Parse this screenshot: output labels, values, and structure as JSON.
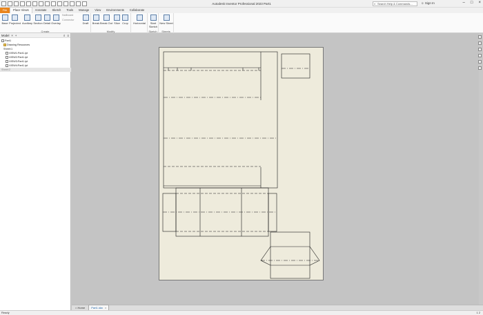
{
  "window": {
    "title": "Autodesk Inventor Professional 2023   Part1",
    "search_placeholder": "Search Help & Commands...",
    "sign_in": "Sign In"
  },
  "tabs": {
    "file": "File",
    "items": [
      "Place Views",
      "Annotate",
      "Sketch",
      "Tools",
      "Manage",
      "View",
      "Environments",
      "Collaborate"
    ]
  },
  "ribbon": {
    "groups": {
      "create": "Create",
      "modify": "Modify",
      "sketch": "Sketch",
      "sheets": "Sheets"
    },
    "buttons": {
      "base": "Base",
      "projected": "Projected",
      "auxiliary": "Auxiliary",
      "section": "Section",
      "detail": "Detail",
      "overlay": "Overlay",
      "draft": "Draft",
      "break": "Break",
      "break_out": "Break Out",
      "slice": "Slice",
      "crop": "Crop",
      "horizontal": "Horizontal",
      "start_sketch": "Start Sketch",
      "new_sheet": "New Sheet"
    },
    "small": {
      "nailboard": "Nailboard",
      "connector": "Connector"
    }
  },
  "browser": {
    "tab": "Model",
    "tree": [
      {
        "label": "Part1",
        "indent": 0,
        "icon": "document-icon"
      },
      {
        "label": "Drawing Resources",
        "indent": 1,
        "icon": "folder-icon"
      },
      {
        "label": "Sheet:1",
        "indent": 1,
        "icon": "sheet-icon"
      },
      {
        "label": "VIEW1:Part1.ipt",
        "indent": 2,
        "icon": "view-icon"
      },
      {
        "label": "VIEW2:Part1.ipt",
        "indent": 2,
        "icon": "view-icon"
      },
      {
        "label": "VIEW3:Part1.ipt",
        "indent": 2,
        "icon": "view-icon"
      },
      {
        "label": "VIEW4:Part1.ipt",
        "indent": 2,
        "icon": "view-icon"
      },
      {
        "label": "Sheet:2",
        "indent": 0,
        "icon": "sheet-icon",
        "selected": true
      }
    ]
  },
  "doc_tabs": {
    "home": "Home",
    "active": "Part1.idw"
  },
  "status": {
    "left": "Ready",
    "right": "1  2"
  },
  "colors": {
    "sheet_bg": "#eeebdc",
    "canvas_bg": "#c4c4c4",
    "file_tab": "#e9841b"
  }
}
